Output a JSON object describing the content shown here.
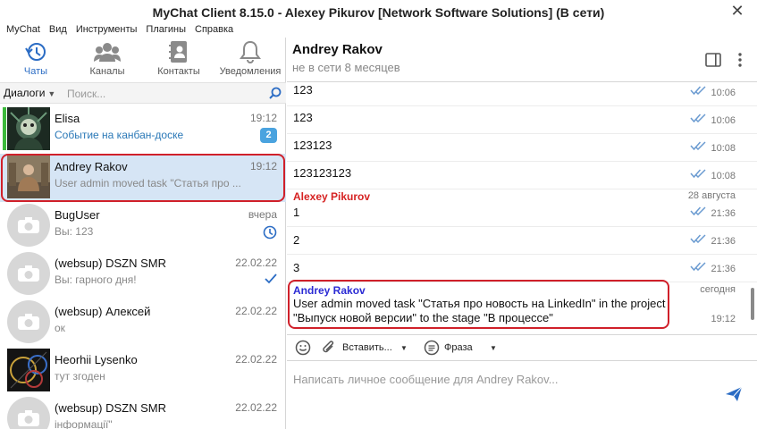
{
  "window": {
    "title": "MyChat Client 8.15.0 - Alexey Pikurov [Network Software Solutions] (В сети)",
    "close": "✕"
  },
  "menu": [
    "MyChat",
    "Вид",
    "Инструменты",
    "Плагины",
    "Справка"
  ],
  "nav_tabs": [
    {
      "label": "Чаты",
      "icon": "history-icon",
      "active": true
    },
    {
      "label": "Каналы",
      "icon": "channels-icon",
      "active": false
    },
    {
      "label": "Контакты",
      "icon": "contacts-icon",
      "active": false
    },
    {
      "label": "Уведомления",
      "icon": "bell-icon",
      "active": false
    }
  ],
  "filter": {
    "dialogs_label": "Диалоги",
    "search_placeholder": "Поиск..."
  },
  "chats": [
    {
      "name": "Elisa",
      "time": "19:12",
      "preview": "Событие на канбан-доске",
      "badge": "2",
      "avatar": "photo-avatar"
    },
    {
      "name": "Andrey Rakov",
      "time": "19:12",
      "preview": "User admin moved task \"Статья про ...",
      "avatar": "photo-avatar",
      "selected": true
    },
    {
      "name": "BugUser",
      "time": "вчера",
      "preview": "Вы: 123",
      "avatar": "camera-placeholder-avatar",
      "status_icon": "clock-icon"
    },
    {
      "name": "(websup) DSZN SMR",
      "time": "22.02.22",
      "preview": "Вы: гарного дня!",
      "avatar": "camera-placeholder-avatar",
      "status_icon": "check-icon"
    },
    {
      "name": "(websup) Алексей",
      "time": "22.02.22",
      "preview": "ок",
      "avatar": "camera-placeholder-avatar"
    },
    {
      "name": "Heorhii Lysenko",
      "time": "22.02.22",
      "preview": "тут згоден",
      "avatar": "photo-avatar"
    },
    {
      "name": "(websup) DSZN SMR",
      "time": "22.02.22",
      "preview": "інформації\"",
      "avatar": "camera-placeholder-avatar"
    }
  ],
  "conversation": {
    "contact_name": "Andrey Rakov",
    "contact_status": "не в сети 8 месяцев",
    "messages_top": [
      {
        "text": "123",
        "time": "10:06"
      },
      {
        "text": "123",
        "time": "10:06"
      },
      {
        "text": "123123",
        "time": "10:08"
      },
      {
        "text": "123123123",
        "time": "10:08"
      }
    ],
    "sender_1": "Alexey Pikurov",
    "date_1": "28 августа",
    "messages_mid": [
      {
        "text": "1",
        "time": "21:36"
      },
      {
        "text": "2",
        "time": "21:36"
      },
      {
        "text": "3",
        "time": "21:36"
      }
    ],
    "sender_2": "Andrey Rakov",
    "date_2": "сегодня",
    "last_message_line1": "User admin moved task \"Статья про новость на LinkedIn\" in the project",
    "last_message_line2": "\"Выпуск новой версии\" to the stage \"В процессе\"",
    "last_message_time": "19:12"
  },
  "composer": {
    "attach_label": "Вставить...",
    "phrase_label": "Фраза",
    "placeholder": "Написать личное сообщение для Andrey Rakov..."
  },
  "colors": {
    "accent": "#2b6cc4",
    "selected_bg": "#d6e5f5",
    "highlight": "#d0202a",
    "sender_red": "#d62222",
    "sender_blue": "#2b2bd4",
    "badge": "#4aa3df",
    "online_stripe": "#3cba3c"
  }
}
